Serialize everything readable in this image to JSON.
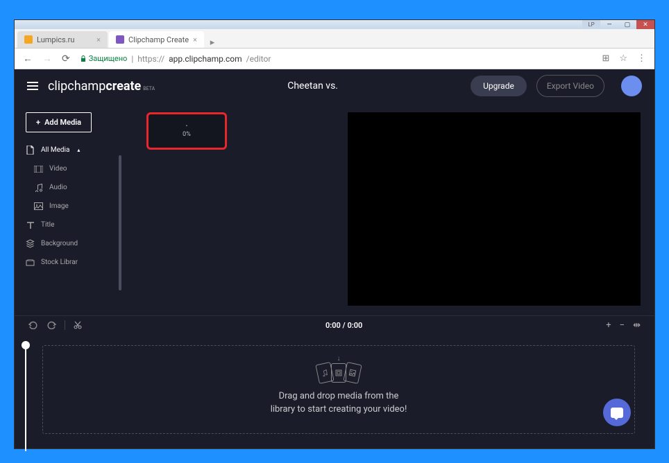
{
  "titlebar": {
    "lp_label": "LP"
  },
  "browser": {
    "tabs": [
      {
        "label": "Lumpics.ru"
      },
      {
        "label": "Clipchamp Create"
      }
    ],
    "secure_label": "Защищено",
    "url_prefix": "https://",
    "url_host": "app.clipchamp.com",
    "url_path": "/editor"
  },
  "header": {
    "logo_prefix": "clipchamp",
    "logo_suffix": "create",
    "logo_beta": "BETA",
    "project_title": "Cheetan vs.",
    "upgrade_label": "Upgrade",
    "export_label": "Export Video"
  },
  "sidebar": {
    "add_media_label": "Add Media",
    "items": [
      {
        "label": "All Media"
      },
      {
        "label": "Video"
      },
      {
        "label": "Audio"
      },
      {
        "label": "Image"
      },
      {
        "label": "Title"
      },
      {
        "label": "Background"
      },
      {
        "label": "Stock Librar"
      }
    ]
  },
  "media": {
    "upload_percent": "0%"
  },
  "timeline": {
    "time_label": "0:00 / 0:00",
    "dropzone_line1": "Drag and drop media from the",
    "dropzone_line2": "library to start creating your video!"
  }
}
